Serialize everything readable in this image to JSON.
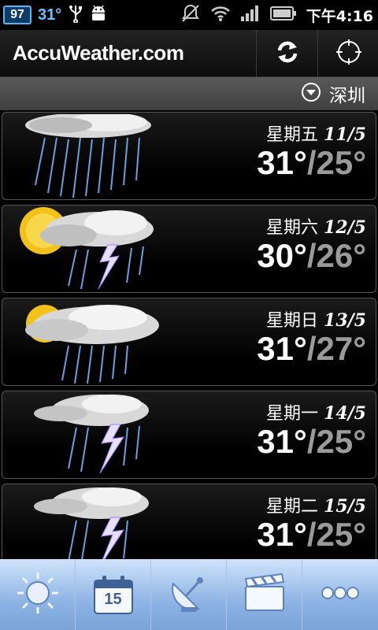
{
  "status_bar": {
    "badge": "97",
    "temperature": "31°",
    "time": "下午4:16"
  },
  "header": {
    "logo": "AccuWeather.com",
    "icons": [
      "refresh-icon",
      "locate-icon"
    ]
  },
  "location": {
    "name": "深圳"
  },
  "forecast": [
    {
      "day": "星期五",
      "date": "11/5",
      "high": "31°",
      "low": "25°",
      "icon": "rain-icon"
    },
    {
      "day": "星期六",
      "date": "12/5",
      "high": "30°",
      "low": "26°",
      "icon": "sun-thunderstorm-icon"
    },
    {
      "day": "星期日",
      "date": "13/5",
      "high": "31°",
      "low": "27°",
      "icon": "sun-rain-icon"
    },
    {
      "day": "星期一",
      "date": "14/5",
      "high": "31°",
      "low": "25°",
      "icon": "thunderstorm-icon"
    },
    {
      "day": "星期二",
      "date": "15/5",
      "high": "31°",
      "low": "25°",
      "icon": "thunderstorm-icon"
    }
  ],
  "bottom_nav": {
    "calendar_day": "15",
    "icons": [
      "sun-icon",
      "calendar-icon",
      "satellite-dish-icon",
      "video-icon",
      "more-icon"
    ]
  },
  "colors": {
    "accent_blue": "#6fc0ff",
    "low_temp": "#9a9a9a",
    "nav_blue": "#8fb4e4"
  }
}
